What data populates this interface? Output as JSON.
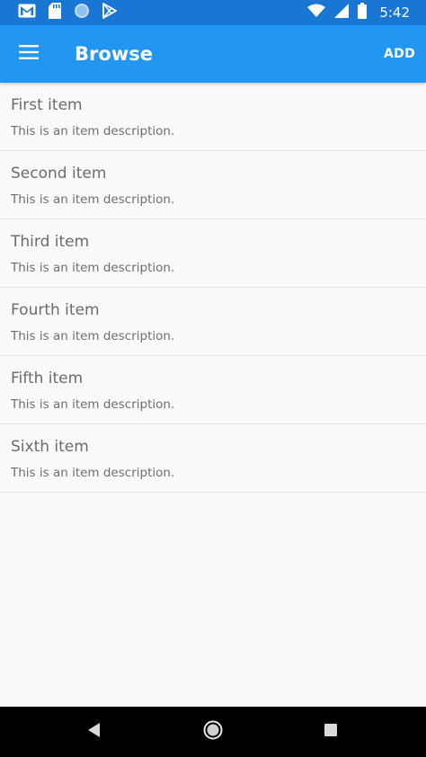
{
  "status_bar": {
    "time": "5:42",
    "left_icons": [
      "gmail-icon",
      "sd-card-icon",
      "circle-notification-icon",
      "play-store-icon"
    ],
    "right_icons": [
      "wifi-icon",
      "cell-signal-icon",
      "battery-icon"
    ]
  },
  "app_bar": {
    "title": "Browse",
    "action_label": "ADD",
    "color": "#2196f3"
  },
  "items": [
    {
      "title": "First item",
      "description": "This is an item description."
    },
    {
      "title": "Second item",
      "description": "This is an item description."
    },
    {
      "title": "Third item",
      "description": "This is an item description."
    },
    {
      "title": "Fourth item",
      "description": "This is an item description."
    },
    {
      "title": "Fifth item",
      "description": "This is an item description."
    },
    {
      "title": "Sixth item",
      "description": "This is an item description."
    }
  ],
  "nav_bar": {
    "buttons": [
      "back-icon",
      "home-icon",
      "recents-icon"
    ]
  }
}
